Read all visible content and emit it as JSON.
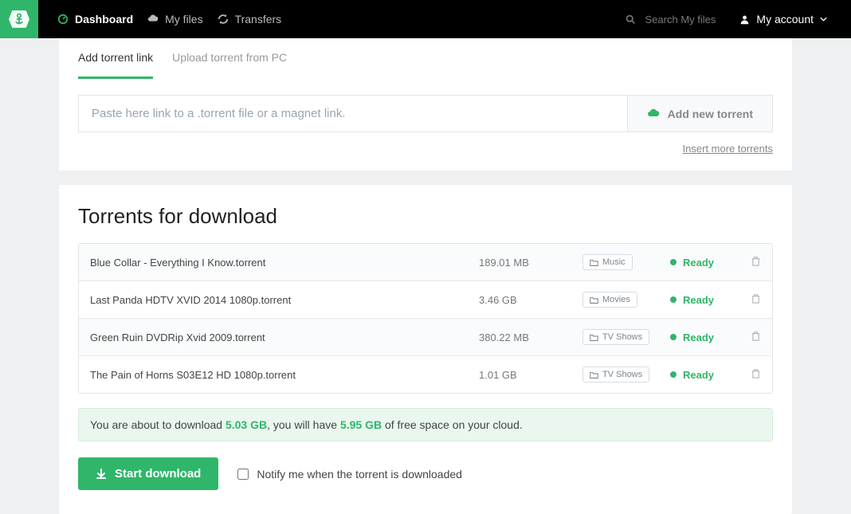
{
  "nav": {
    "dashboard": "Dashboard",
    "myfiles": "My files",
    "transfers": "Transfers"
  },
  "search": {
    "placeholder": "Search My files"
  },
  "account": {
    "label": "My account"
  },
  "tabs": {
    "add_link": "Add torrent link",
    "upload_pc": "Upload torrent from PC"
  },
  "input": {
    "placeholder": "Paste here link to a .torrent file or a magnet link.",
    "button": "Add new torrent"
  },
  "more_link": "Insert more torrents",
  "section_title": "Torrents for download",
  "torrents": [
    {
      "name": "Blue Collar - Everything I Know.torrent",
      "size": "189.01 MB",
      "category": "Music",
      "status": "Ready"
    },
    {
      "name": "Last Panda HDTV XVID 2014 1080p.torrent",
      "size": "3.46 GB",
      "category": "Movies",
      "status": "Ready"
    },
    {
      "name": "Green Ruin DVDRip Xvid 2009.torrent",
      "size": "380.22 MB",
      "category": "TV Shows",
      "status": "Ready"
    },
    {
      "name": "The Pain of Horns S03E12 HD 1080p.torrent",
      "size": "1.01 GB",
      "category": "TV Shows",
      "status": "Ready"
    }
  ],
  "summary": {
    "pre": "You are about to download ",
    "total": "5.03 GB",
    "mid": ", you will have ",
    "free": "5.95 GB",
    "post": " of free space on your cloud."
  },
  "actions": {
    "start": "Start download",
    "notify": "Notify me when the torrent is downloaded"
  }
}
